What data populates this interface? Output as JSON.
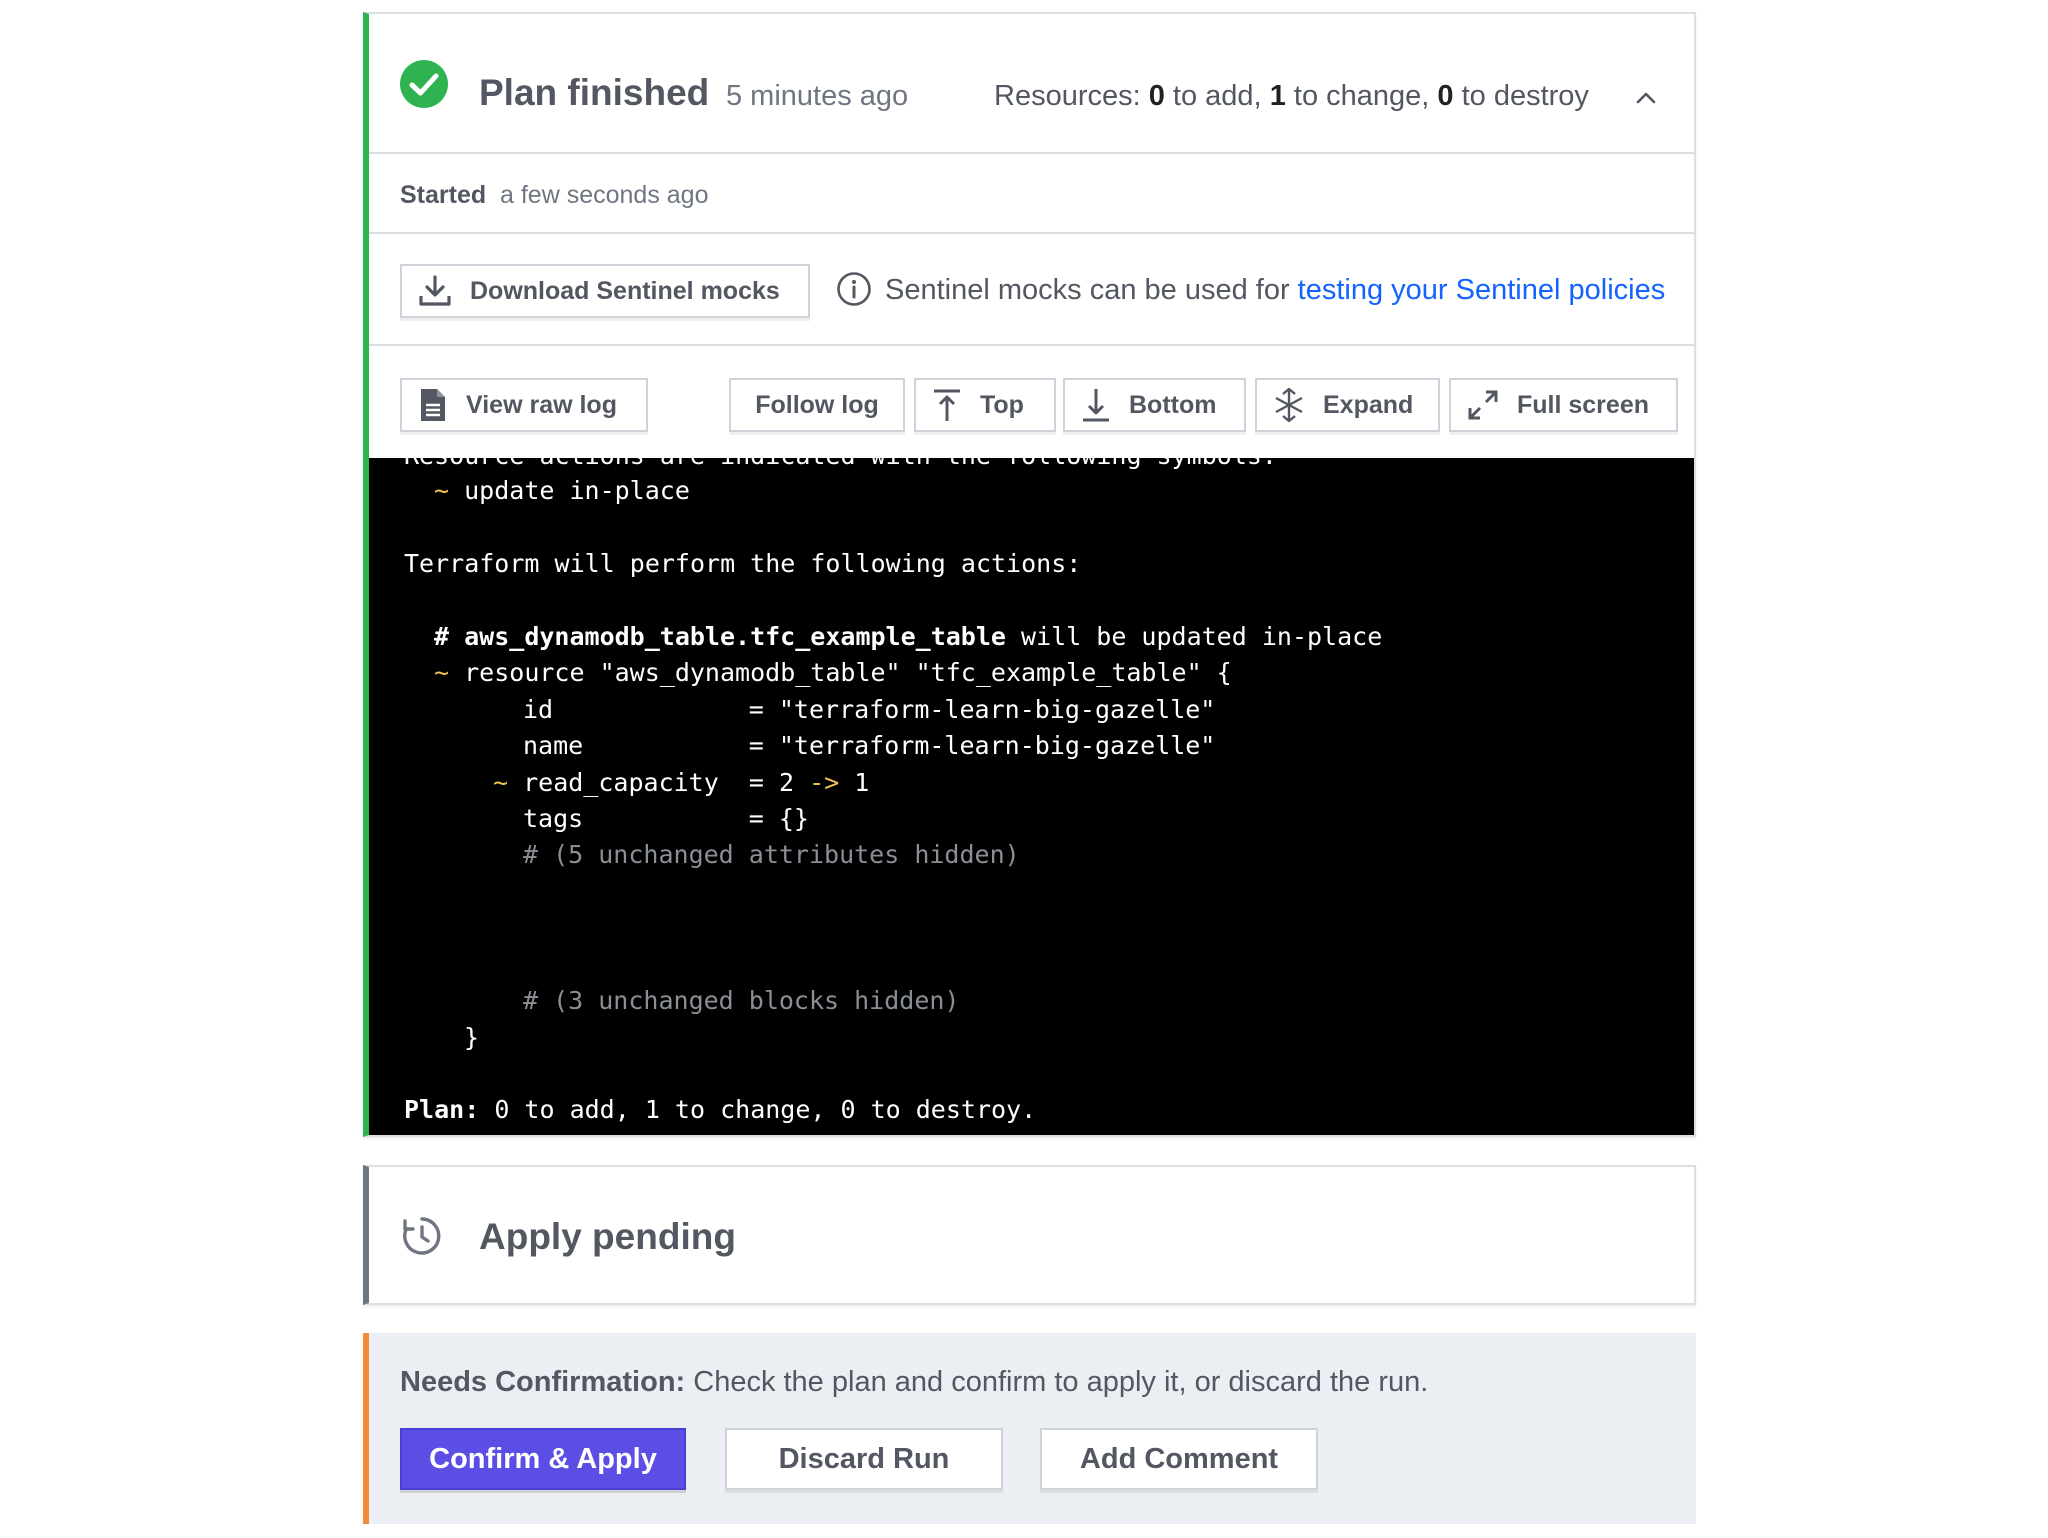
{
  "plan": {
    "status_icon": "check-circle-icon",
    "title": "Plan finished",
    "time": "5 minutes ago",
    "resources": {
      "prefix": "Resources: ",
      "add_count": "0",
      "add_label": " to add, ",
      "change_count": "1",
      "change_label": " to change, ",
      "destroy_count": "0",
      "destroy_label": " to destroy"
    },
    "collapse_icon": "chevron-up-icon",
    "started_label": "Started",
    "started_value": "a few seconds ago",
    "download_mocks_label": "Download Sentinel mocks",
    "sentinel_info_text": "Sentinel mocks can be used for ",
    "sentinel_info_link": "testing your Sentinel policies",
    "toolbar": {
      "view_raw_log": "View raw log",
      "follow_log": "Follow log",
      "top": "Top",
      "bottom": "Bottom",
      "expand": "Expand",
      "full_screen": "Full screen"
    }
  },
  "terminal": {
    "cut_line": "Resource actions are indicated with the following symbols:",
    "l1_sym": "~",
    "l1_text": " update in-place",
    "l2": "Terraform will perform the following actions:",
    "l3_hash": "# ",
    "l3_name": "aws_dynamodb_table.tfc_example_table",
    "l3_rest": " will be updated in-place",
    "l4_sym": "~",
    "l4_text": " resource \"aws_dynamodb_table\" \"tfc_example_table\" {",
    "l5": "id             = \"terraform-learn-big-gazelle\"",
    "l6": "name           = \"terraform-learn-big-gazelle\"",
    "l7_sym": "~",
    "l7_a": " read_capacity  = 2 ",
    "l7_arrow": "->",
    "l7_b": " 1",
    "l8": "tags           = {}",
    "l9": "# (5 unchanged attributes hidden)",
    "l10": "# (3 unchanged blocks hidden)",
    "l11": "}",
    "l12_label": "Plan:",
    "l12_text": " 0 to add, 1 to change, 0 to destroy."
  },
  "apply": {
    "icon": "clock-pending-icon",
    "title": "Apply pending"
  },
  "confirm": {
    "label": "Needs Confirmation:",
    "text": " Check the plan and confirm to apply it, or discard the run.",
    "confirm_button": "Confirm & Apply",
    "discard_button": "Discard Run",
    "comment_button": "Add Comment"
  },
  "colors": {
    "success": "#2fb351",
    "warning": "#f28c38",
    "primary": "#5c4ee5",
    "link": "#1563ff",
    "terminal_bg": "#000000",
    "terminal_symbol": "#f1c34b"
  }
}
